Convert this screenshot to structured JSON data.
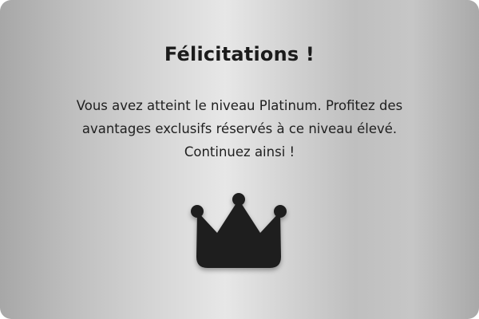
{
  "dialog": {
    "title": "Félicitations !",
    "message": " Vous avez atteint le niveau Platinum. Profitez des avantages exclusifs réservés à ce niveau élevé. Continuez ainsi !",
    "icon": "crown-icon",
    "colors": {
      "text": "#1b1b1b",
      "icon": "#1e1e1e",
      "background_light": "#e7e7e7",
      "background_dark": "#a7a7a7"
    }
  }
}
